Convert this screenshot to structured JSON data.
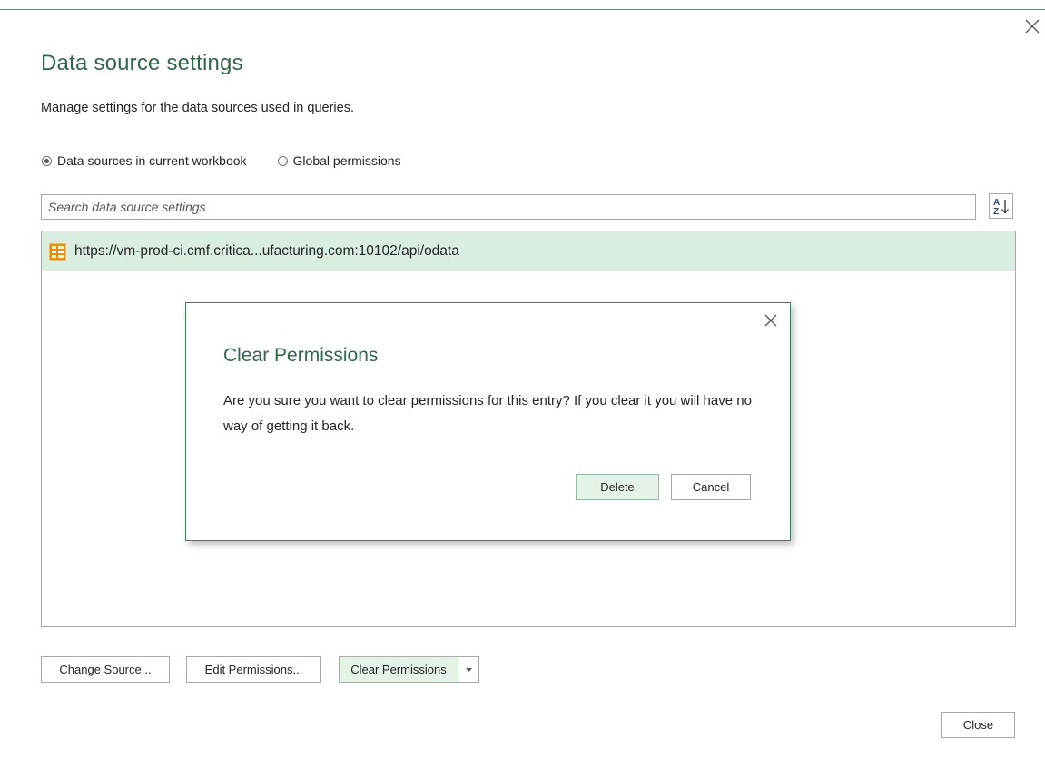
{
  "window": {
    "title": "Data source settings",
    "subtitle": "Manage settings for the data sources used in queries.",
    "close_icon": "close-icon"
  },
  "scope": {
    "options": [
      {
        "label": "Data sources in current workbook",
        "selected": true
      },
      {
        "label": "Global permissions",
        "selected": false
      }
    ]
  },
  "search": {
    "placeholder": "Search data source settings",
    "value": "",
    "sort_icon": "sort-az-icon"
  },
  "sources": [
    {
      "url": "https://vm-prod-ci.cmf.critica...ufacturing.com:10102/api/odata",
      "icon": "odata-feed-icon",
      "selected": true
    }
  ],
  "dialog": {
    "title": "Clear Permissions",
    "message": "Are you sure you want to clear permissions for this entry? If you clear it you will have no way of getting it back.",
    "delete_label": "Delete",
    "cancel_label": "Cancel"
  },
  "actions": {
    "change_source_label": "Change Source...",
    "edit_permissions_label": "Edit Permissions...",
    "clear_permissions_label": "Clear Permissions",
    "close_label": "Close"
  },
  "colors": {
    "accent": "#2d6a46",
    "selection": "#d9ede0",
    "primary_button": "#e4f2e8",
    "icon_orange": "#f28c00"
  }
}
